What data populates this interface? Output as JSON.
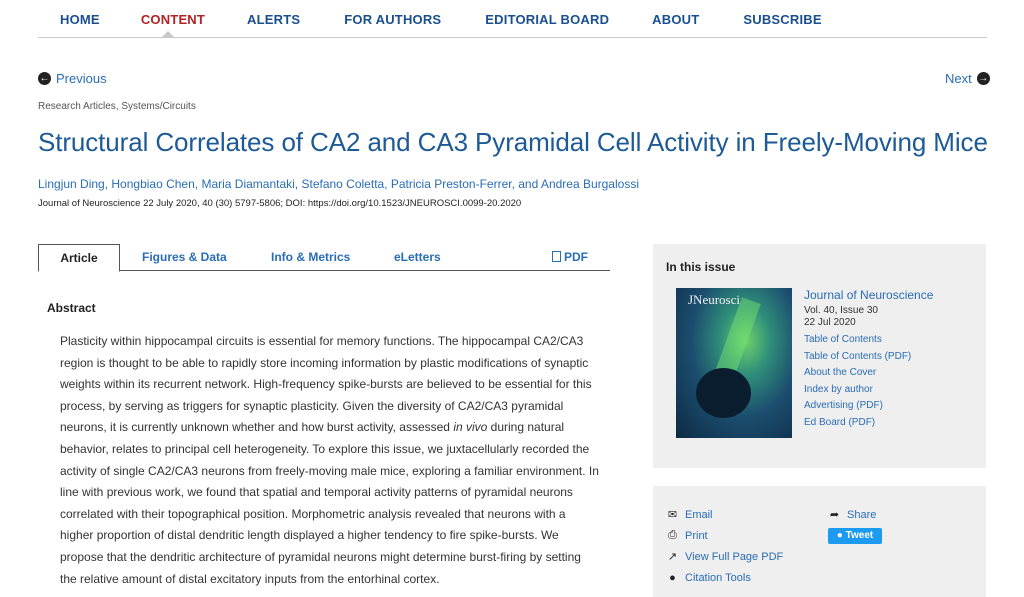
{
  "nav": {
    "items": [
      {
        "label": "HOME",
        "active": false
      },
      {
        "label": "CONTENT",
        "active": true
      },
      {
        "label": "ALERTS",
        "active": false
      },
      {
        "label": "FOR AUTHORS",
        "active": false
      },
      {
        "label": "EDITORIAL BOARD",
        "active": false
      },
      {
        "label": "ABOUT",
        "active": false
      },
      {
        "label": "SUBSCRIBE",
        "active": false
      }
    ]
  },
  "pager": {
    "previous": "Previous",
    "next": "Next"
  },
  "article": {
    "breadcrumb": "Research Articles, Systems/Circuits",
    "title": "Structural Correlates of CA2 and CA3 Pyramidal Cell Activity in Freely-Moving Mice",
    "authors": "Lingjun Ding, Hongbiao Chen, Maria Diamantaki, Stefano Coletta, Patricia Preston-Ferrer, and Andrea Burgalossi",
    "citation": "Journal of Neuroscience 22 July 2020, 40 (30) 5797-5806; DOI: https://doi.org/10.1523/JNEUROSCI.0099-20.2020"
  },
  "tabs": {
    "article": "Article",
    "figures": "Figures & Data",
    "info": "Info & Metrics",
    "eletters": "eLetters",
    "pdf": "PDF"
  },
  "abstract": {
    "heading": "Abstract",
    "text_before_italic": "Plasticity within hippocampal circuits is essential for memory functions. The hippocampal CA2/CA3 region is thought to be able to rapidly store incoming information by plastic modifications of synaptic weights within its recurrent network. High-frequency spike-bursts are believed to be essential for this process, by serving as triggers for synaptic plasticity. Given the diversity of CA2/CA3 pyramidal neurons, it is currently unknown whether and how burst activity, assessed ",
    "italic": "in vivo",
    "text_after_italic": " during natural behavior, relates to principal cell heterogeneity. To explore this issue, we juxtacellularly recorded the activity of single CA2/CA3 neurons from freely-moving male mice, exploring a familiar environment. In line with previous work, we found that spatial and temporal activity patterns of pyramidal neurons correlated with their topographical position. Morphometric analysis revealed that neurons with a higher proportion of distal dendritic length displayed a higher tendency to fire spike-bursts. We propose that the dendritic architecture of pyramidal neurons might determine burst-firing by setting the relative amount of distal excitatory inputs from the entorhinal cortex."
  },
  "issue": {
    "heading": "In this issue",
    "cover_masthead": "JNeurosci",
    "journal": "Journal of Neuroscience",
    "volume": "Vol. 40, Issue 30",
    "date": "22 Jul 2020",
    "links": [
      "Table of Contents",
      "Table of Contents (PDF)",
      "About the Cover",
      "Index by author",
      "Advertising (PDF)",
      "Ed Board (PDF)"
    ]
  },
  "tools": {
    "email": "Email",
    "print": "Print",
    "full_pdf": "View Full Page PDF",
    "citation": "Citation Tools",
    "share": "Share",
    "tweet": "Tweet"
  }
}
